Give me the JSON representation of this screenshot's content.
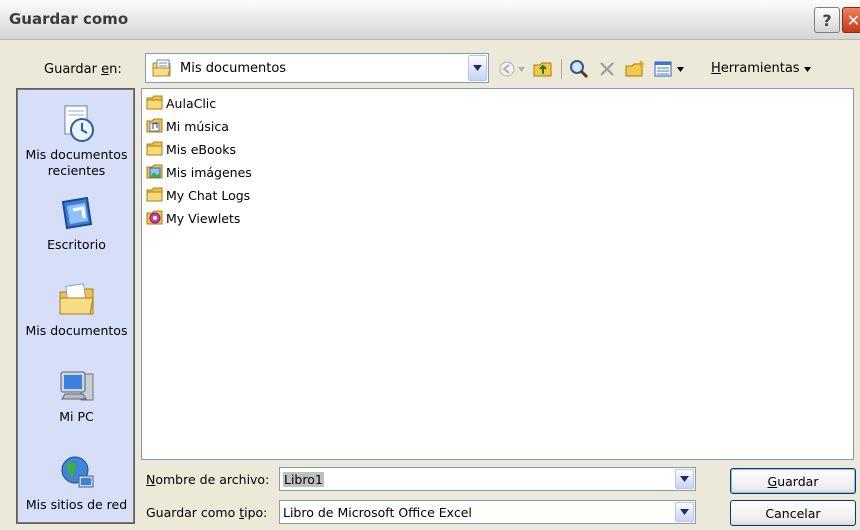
{
  "window": {
    "title": "Guardar como"
  },
  "save_in": {
    "label_pre": "Guardar ",
    "label_key": "e",
    "label_post": "n:",
    "value": "Mis documentos"
  },
  "toolbar": {
    "tools_key": "H",
    "tools_rest": "erramientas"
  },
  "places": [
    {
      "label": "Mis documentos recientes",
      "icon": "recent-documents-icon"
    },
    {
      "label": "Escritorio",
      "icon": "desktop-icon"
    },
    {
      "label": "Mis documentos",
      "icon": "my-documents-icon"
    },
    {
      "label": "Mi PC",
      "icon": "my-computer-icon"
    },
    {
      "label": "Mis sitios de red",
      "icon": "network-places-icon"
    }
  ],
  "files": [
    {
      "name": "AulaClic",
      "icon": "folder-icon"
    },
    {
      "name": "Mi música",
      "icon": "music-folder-icon"
    },
    {
      "name": "Mis eBooks",
      "icon": "folder-icon"
    },
    {
      "name": "Mis imágenes",
      "icon": "pictures-folder-icon"
    },
    {
      "name": "My Chat Logs",
      "icon": "folder-icon"
    },
    {
      "name": "My Viewlets",
      "icon": "viewlets-folder-icon"
    }
  ],
  "filename": {
    "label_key": "N",
    "label_rest": "ombre de archivo:",
    "value": "Libro1"
  },
  "filetype": {
    "label_pre": "Guardar como ",
    "label_key": "t",
    "label_post": "ipo:",
    "value": "Libro de Microsoft Office Excel"
  },
  "buttons": {
    "save_key": "G",
    "save_rest": "uardar",
    "cancel": "Cancelar"
  },
  "colors": {
    "places_bg": "#d6dff7",
    "dialog_bg": "#ECE9D8",
    "border_blue": "#7f9db9"
  }
}
